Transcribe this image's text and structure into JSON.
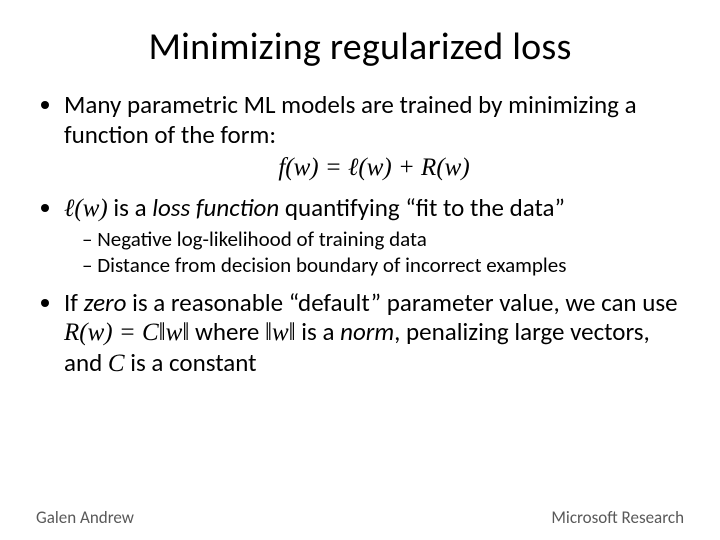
{
  "title": "Minimizing regularized loss",
  "bullet1": {
    "text": "Many parametric ML models are trained by minimizing a function of the form:",
    "equation": "f(w) = ℓ(w) + R(w)"
  },
  "bullet2": {
    "lead_math": "ℓ(w)",
    "text_before_italic": " is a ",
    "italic": "loss function",
    "text_after_italic": " quantifying “fit to the data”",
    "sub1": "Negative log-likelihood of training data",
    "sub2": "Distance from decision boundary of incorrect examples"
  },
  "bullet3": {
    "part1": "If ",
    "italic1": "zero",
    "part2": " is a reasonable “default” parameter value, we can use ",
    "math1": "R(w) = C‖w‖",
    "part3": " where ",
    "math2": "‖w‖",
    "part4": " is a ",
    "italic2": "norm",
    "part5": ", penalizing large vectors, and ",
    "math3": "C",
    "part6": " is a constant"
  },
  "footer": {
    "left": "Galen Andrew",
    "right": "Microsoft Research"
  }
}
